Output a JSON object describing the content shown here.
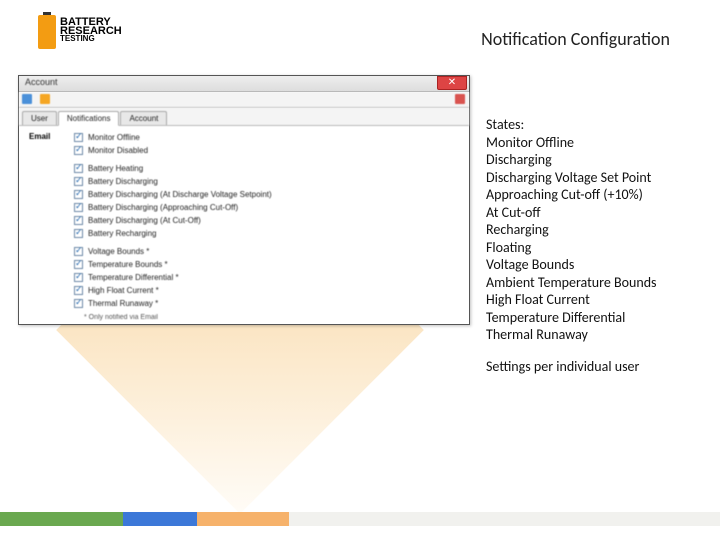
{
  "slide": {
    "title": "Notification Configuration"
  },
  "logo": {
    "line1": "BATTERY",
    "line2": "RESEARCH",
    "line3": "TESTING"
  },
  "window": {
    "title": "Account",
    "close_label": "✕",
    "tabs": [
      "User",
      "Notifications",
      "Account"
    ],
    "active_tab": 1,
    "section_label": "Email",
    "items": [
      {
        "label": "Monitor Offline",
        "checked": true
      },
      {
        "label": "Monitor Disabled",
        "checked": true
      },
      {
        "label": "Battery Heating",
        "checked": true
      },
      {
        "label": "Battery Discharging",
        "checked": true
      },
      {
        "label": "Battery Discharging (At Discharge Voltage Setpoint)",
        "checked": true
      },
      {
        "label": "Battery Discharging (Approaching Cut-Off)",
        "checked": true
      },
      {
        "label": "Battery Discharging (At Cut-Off)",
        "checked": true
      },
      {
        "label": "Battery Recharging",
        "checked": true
      },
      {
        "label": "Voltage Bounds *",
        "checked": true
      },
      {
        "label": "Temperature Bounds *",
        "checked": true
      },
      {
        "label": "Temperature Differential *",
        "checked": true
      },
      {
        "label": "High Float Current *",
        "checked": true
      },
      {
        "label": "Thermal Runaway *",
        "checked": true
      }
    ],
    "note": "* Only notified via Email"
  },
  "states": {
    "heading": "States:",
    "items": [
      "Monitor Offline",
      "Discharging",
      "Discharging Voltage Set Point",
      "Approaching Cut-off (+10%)",
      "At Cut-off",
      "Recharging",
      "Floating",
      "Voltage Bounds",
      "Ambient Temperature Bounds",
      "High Float Current",
      "Temperature Differential",
      "Thermal Runaway"
    ],
    "footer": "Settings per individual user"
  }
}
